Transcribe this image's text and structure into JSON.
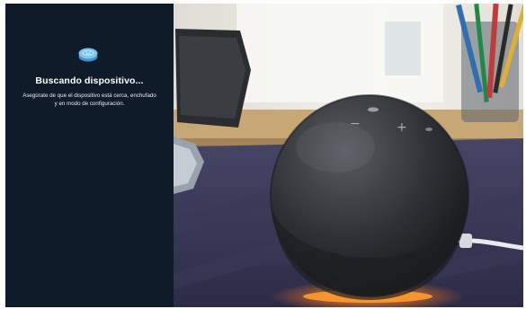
{
  "setup": {
    "icon": "echo-device-icon",
    "title": "Buscando dispositivo...",
    "description_line1": "Asegúrate de que el dispositivo está cerca, enchufado",
    "description_line2": "y en modo de configuración."
  },
  "photo": {
    "subject": "smart-speaker-photo"
  },
  "colors": {
    "panel_background": "#0f1b29",
    "icon_accent": "#7ec4ee",
    "text": "#ffffff"
  }
}
